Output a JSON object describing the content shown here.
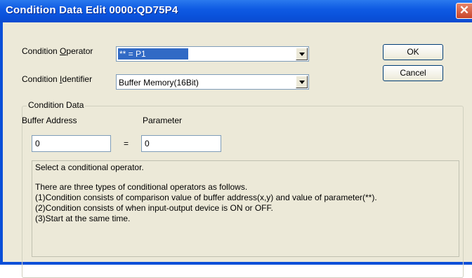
{
  "window": {
    "title": "Condition Data Edit 0000:QD75P4",
    "close_glyph": "✕"
  },
  "condition_operator": {
    "label_before": "Condition ",
    "label_mnemonic": "O",
    "label_after": "perator",
    "value": "** = P1"
  },
  "condition_identifier": {
    "label_before": "Condition ",
    "label_mnemonic": "I",
    "label_after": "dentifier",
    "value": "Buffer Memory(16Bit)"
  },
  "buttons": {
    "ok": "OK",
    "cancel": "Cancel"
  },
  "condition_data": {
    "group_label": "Condition Data",
    "buffer_address_label": "Buffer Address",
    "parameter_label": "Parameter",
    "buffer_address_value": "0",
    "equals": "=",
    "parameter_value": "0"
  },
  "description": {
    "lines": [
      "Select a conditional operator.",
      "There are three types of conditional operators as follows.",
      "(1)Condition consists of comparison value of buffer address(x,y) and value of parameter(**).",
      "(2)Condition consists of when input-output device is ON or OFF.",
      "(3)Start at the same time."
    ]
  }
}
